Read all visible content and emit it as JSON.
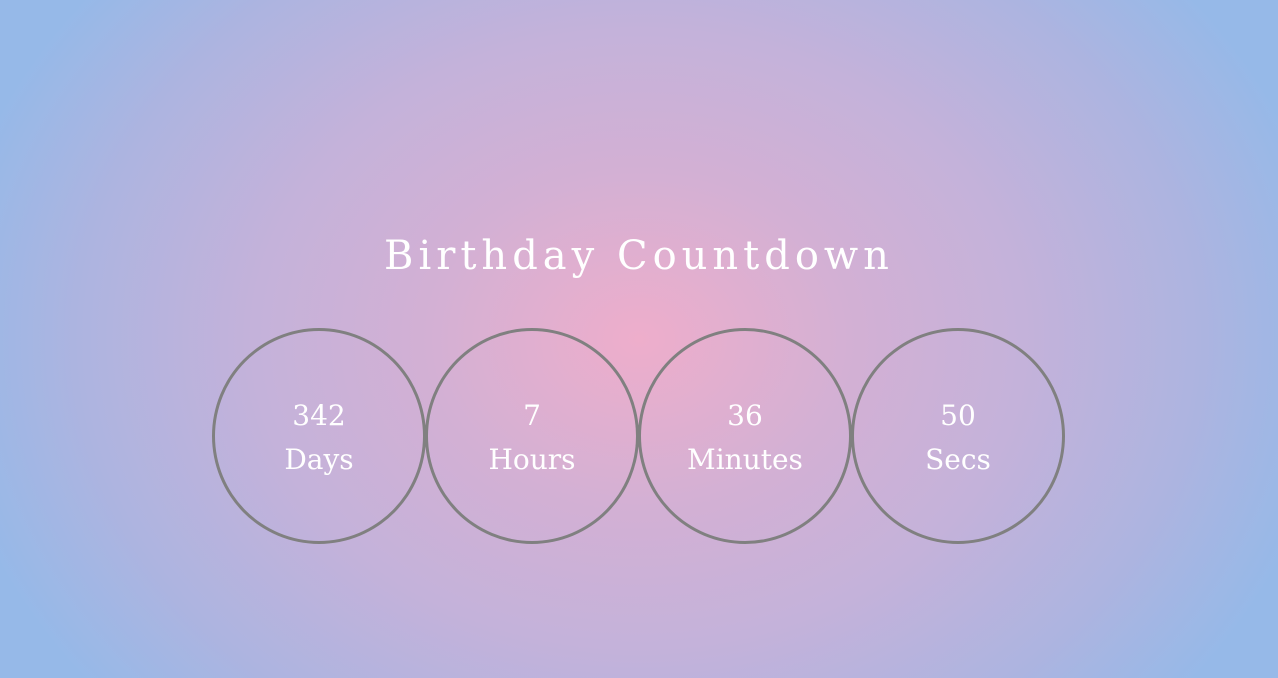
{
  "title": "Birthday Countdown",
  "countdown": [
    {
      "value": "342",
      "label": "Days"
    },
    {
      "value": "7",
      "label": "Hours"
    },
    {
      "value": "36",
      "label": "Minutes"
    },
    {
      "value": "50",
      "label": "Secs"
    }
  ],
  "colors": {
    "ring": "#808080",
    "text": "#ffffff",
    "bg_center": "#eeaecb",
    "bg_edge": "#96b9e8"
  }
}
